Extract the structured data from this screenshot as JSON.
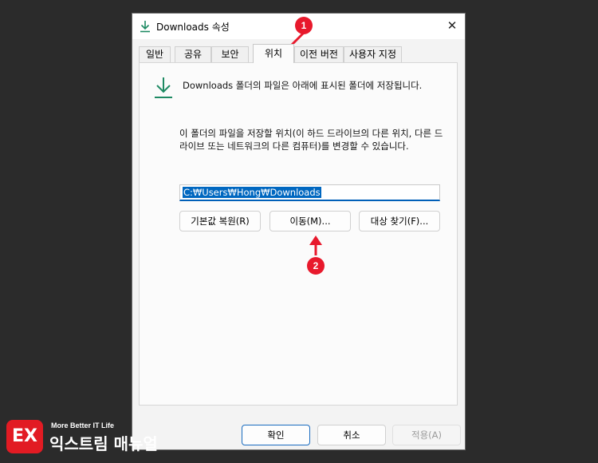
{
  "window": {
    "title": "Downloads 속성",
    "close_glyph": "✕"
  },
  "tabs": [
    {
      "label": "일반"
    },
    {
      "label": "공유"
    },
    {
      "label": "보안"
    },
    {
      "label": "위치",
      "active": true
    },
    {
      "label": "이전 버전"
    },
    {
      "label": "사용자 지정"
    }
  ],
  "location": {
    "description": "Downloads 폴더의 파일은 아래에 표시된 폴더에 저장됩니다.",
    "instruction": "이 폴더의 파일을 저장할 위치(이 하드 드라이브의 다른 위치, 다른 드라이브 또는 네트워크의 다른 컴퓨터)를 변경할 수 있습니다.",
    "path_value": "C:₩Users₩Hong₩Downloads"
  },
  "buttons": {
    "restore_default": "기본값 복원(R)",
    "move": "이동(M)...",
    "find_target": "대상 찾기(F)..."
  },
  "footer": {
    "ok": "확인",
    "cancel": "취소",
    "apply": "적용(A)"
  },
  "annotations": {
    "step1": "1",
    "step2": "2"
  },
  "watermark": {
    "tagline": "More Better IT Life",
    "name": "익스트림 매뉴얼",
    "mark": "EX"
  },
  "colors": {
    "accent": "#005fb8",
    "badge": "#e8192c",
    "download_icon": "#1e8a63"
  },
  "icons": [
    "download-icon",
    "close-icon",
    "arrow-icon"
  ]
}
